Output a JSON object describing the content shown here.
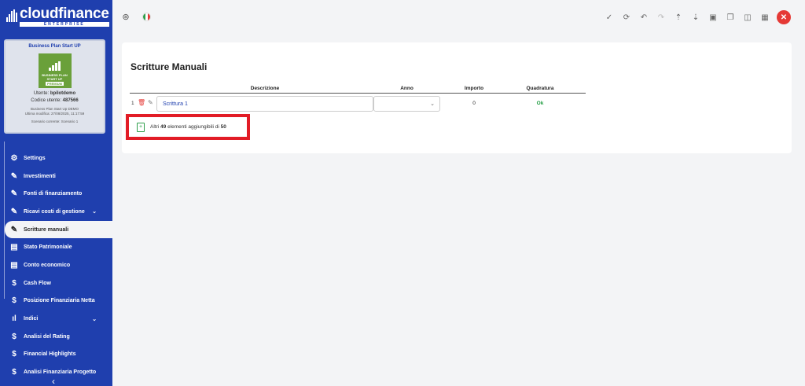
{
  "app": {
    "logo_main": "cloudfinance",
    "logo_sub": "ENTERPRISE"
  },
  "profile": {
    "title": "Business Plan Start UP",
    "image_line1": "BUSINESS PLAN",
    "image_line2": "START UP",
    "image_line3": "PREMIUM",
    "utente_label": "Utente:",
    "utente_value": "bpilotdemo",
    "codice_label": "Codice utente:",
    "codice_value": "487566",
    "company": "Business Plan Start Up DEMO",
    "last_modified": "Ultima modifica: 27/08/2025, 11:17:59",
    "scenario": "Scenario corrente: Scenario 1"
  },
  "sidebar": {
    "items": [
      {
        "label": "Settings",
        "icon": "gear-icon",
        "glyph": "⚙"
      },
      {
        "label": "Investimenti",
        "icon": "edit-icon",
        "glyph": "✎"
      },
      {
        "label": "Fonti di finanziamento",
        "icon": "edit-icon",
        "glyph": "✎"
      },
      {
        "label": "Ricavi costi di gestione",
        "icon": "edit-icon",
        "glyph": "✎",
        "chevron": "⌄"
      },
      {
        "label": "Scritture manuali",
        "icon": "edit-icon",
        "glyph": "✎",
        "active": true
      },
      {
        "label": "Stato Patrimoniale",
        "icon": "document-icon",
        "glyph": "▤"
      },
      {
        "label": "Conto economico",
        "icon": "document-icon",
        "glyph": "▤"
      },
      {
        "label": "Cash Flow",
        "icon": "dollar-icon",
        "glyph": "$"
      },
      {
        "label": "Posizione Finanziaria Netta",
        "icon": "dollar-icon",
        "glyph": "$"
      },
      {
        "label": "Indici",
        "icon": "bar-chart-icon",
        "glyph": "ıl",
        "chevron": "⌄"
      },
      {
        "label": "Analisi del Rating",
        "icon": "dollar-icon",
        "glyph": "$"
      },
      {
        "label": "Financial Highlights",
        "icon": "dollar-icon",
        "glyph": "$"
      },
      {
        "label": "Analisi Finanziaria Progetto",
        "icon": "dollar-icon",
        "glyph": "$"
      }
    ],
    "collapse_glyph": "‹"
  },
  "main": {
    "title": "Scritture Manuali",
    "columns": {
      "descrizione": "Descrizione",
      "anno": "Anno",
      "importo": "Importo",
      "quadratura": "Quadratura"
    },
    "rows": [
      {
        "num": "1",
        "descrizione": "Scrittura 1",
        "anno": "",
        "importo": "0",
        "quadratura": "Ok"
      }
    ],
    "add": {
      "prefix": "Altri",
      "count": "49",
      "middle": "elementi aggiungibili di",
      "total": "50"
    }
  },
  "colors": {
    "brand": "#1f3fae",
    "ok": "#1b9a3c",
    "danger": "#e53935",
    "highlight": "#e21c26"
  }
}
